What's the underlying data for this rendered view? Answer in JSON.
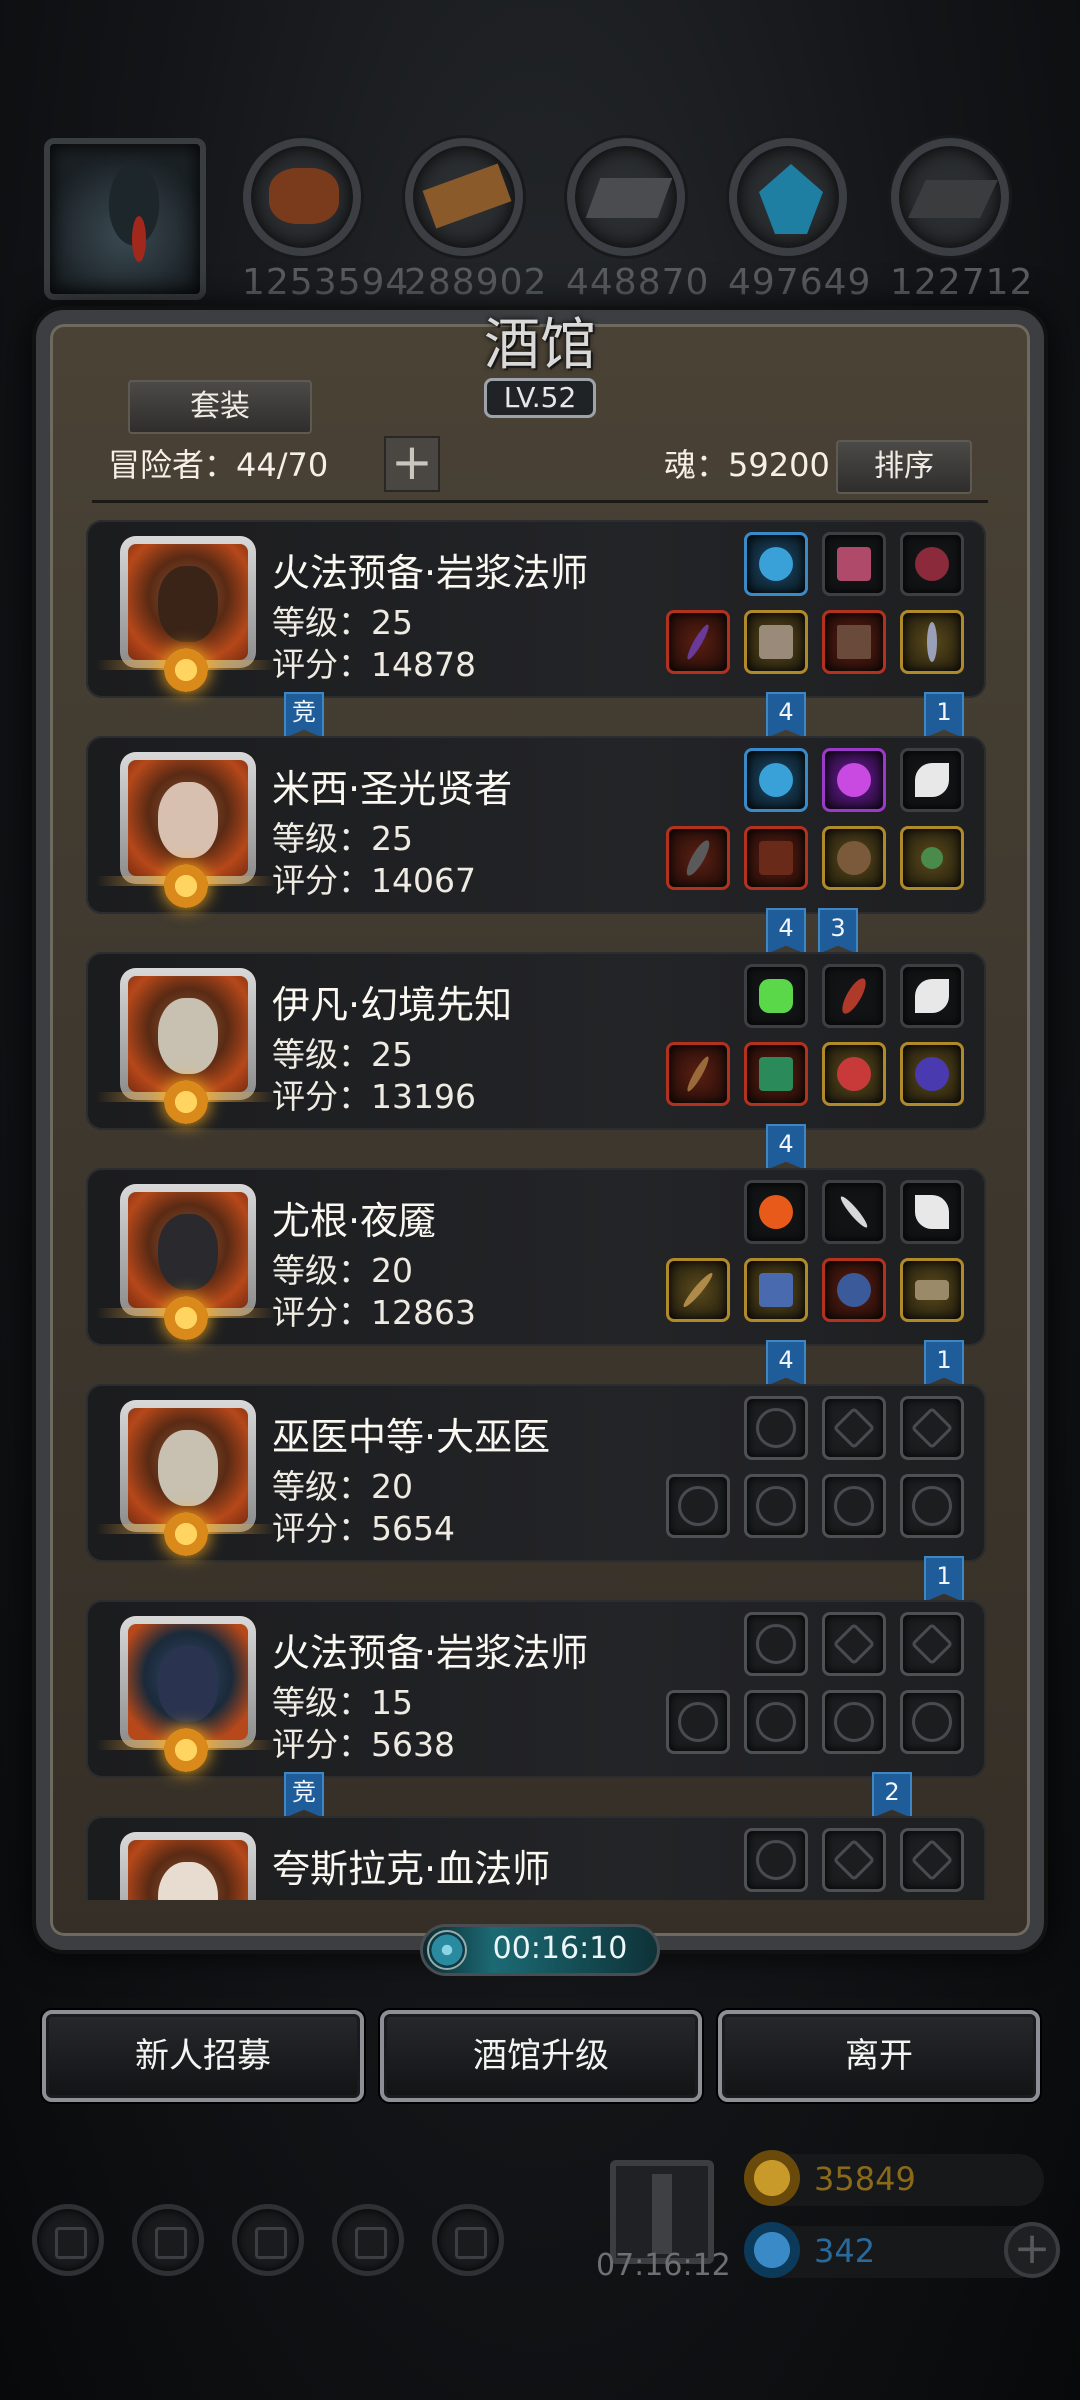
{
  "resources": [
    {
      "icon": "meat-icon",
      "value": "1253594"
    },
    {
      "icon": "wood-icon",
      "value": "288902"
    },
    {
      "icon": "iron-icon",
      "value": "448870"
    },
    {
      "icon": "crystal-icon",
      "value": "497649"
    },
    {
      "icon": "stone-icon",
      "value": "122712"
    }
  ],
  "panel": {
    "title": "酒馆",
    "level": "LV.52",
    "set_button": "套装",
    "adventurers": "冒险者：44/70",
    "souls": "魂：59200",
    "sort_button": "排序"
  },
  "heroes": [
    {
      "name": "火法预备·岩浆法师",
      "level": "等级：25",
      "score": "评分：14878",
      "flags": [
        "竞",
        "4",
        "1"
      ]
    },
    {
      "name": "米西·圣光贤者",
      "level": "等级：25",
      "score": "评分：14067",
      "flags": [
        "4",
        "3"
      ]
    },
    {
      "name": "伊凡·幻境先知",
      "level": "等级：25",
      "score": "评分：13196",
      "flags": [
        "4"
      ]
    },
    {
      "name": "尤根·夜魇",
      "level": "等级：20",
      "score": "评分：12863",
      "flags": [
        "4",
        "1"
      ]
    },
    {
      "name": "巫医中等·大巫医",
      "level": "等级：20",
      "score": "评分：5654",
      "flags": [
        "1"
      ]
    },
    {
      "name": "火法预备·岩浆法师",
      "level": "等级：15",
      "score": "评分：5638",
      "flags": [
        "竞",
        "2"
      ]
    },
    {
      "name": "夸斯拉克·血法师",
      "level": "等级：",
      "score": "",
      "flags": []
    }
  ],
  "timer": "00:16:10",
  "buttons": {
    "recruit": "新人招募",
    "upgrade": "酒馆升级",
    "leave": "离开"
  },
  "gift_timer": "07:16:12",
  "currency": {
    "gold": "35849",
    "gems": "342"
  },
  "colors": {
    "gold_text": "#8a6a1a",
    "gem_text": "#2a6a9a",
    "flag_blue": "#1f5d9a"
  }
}
